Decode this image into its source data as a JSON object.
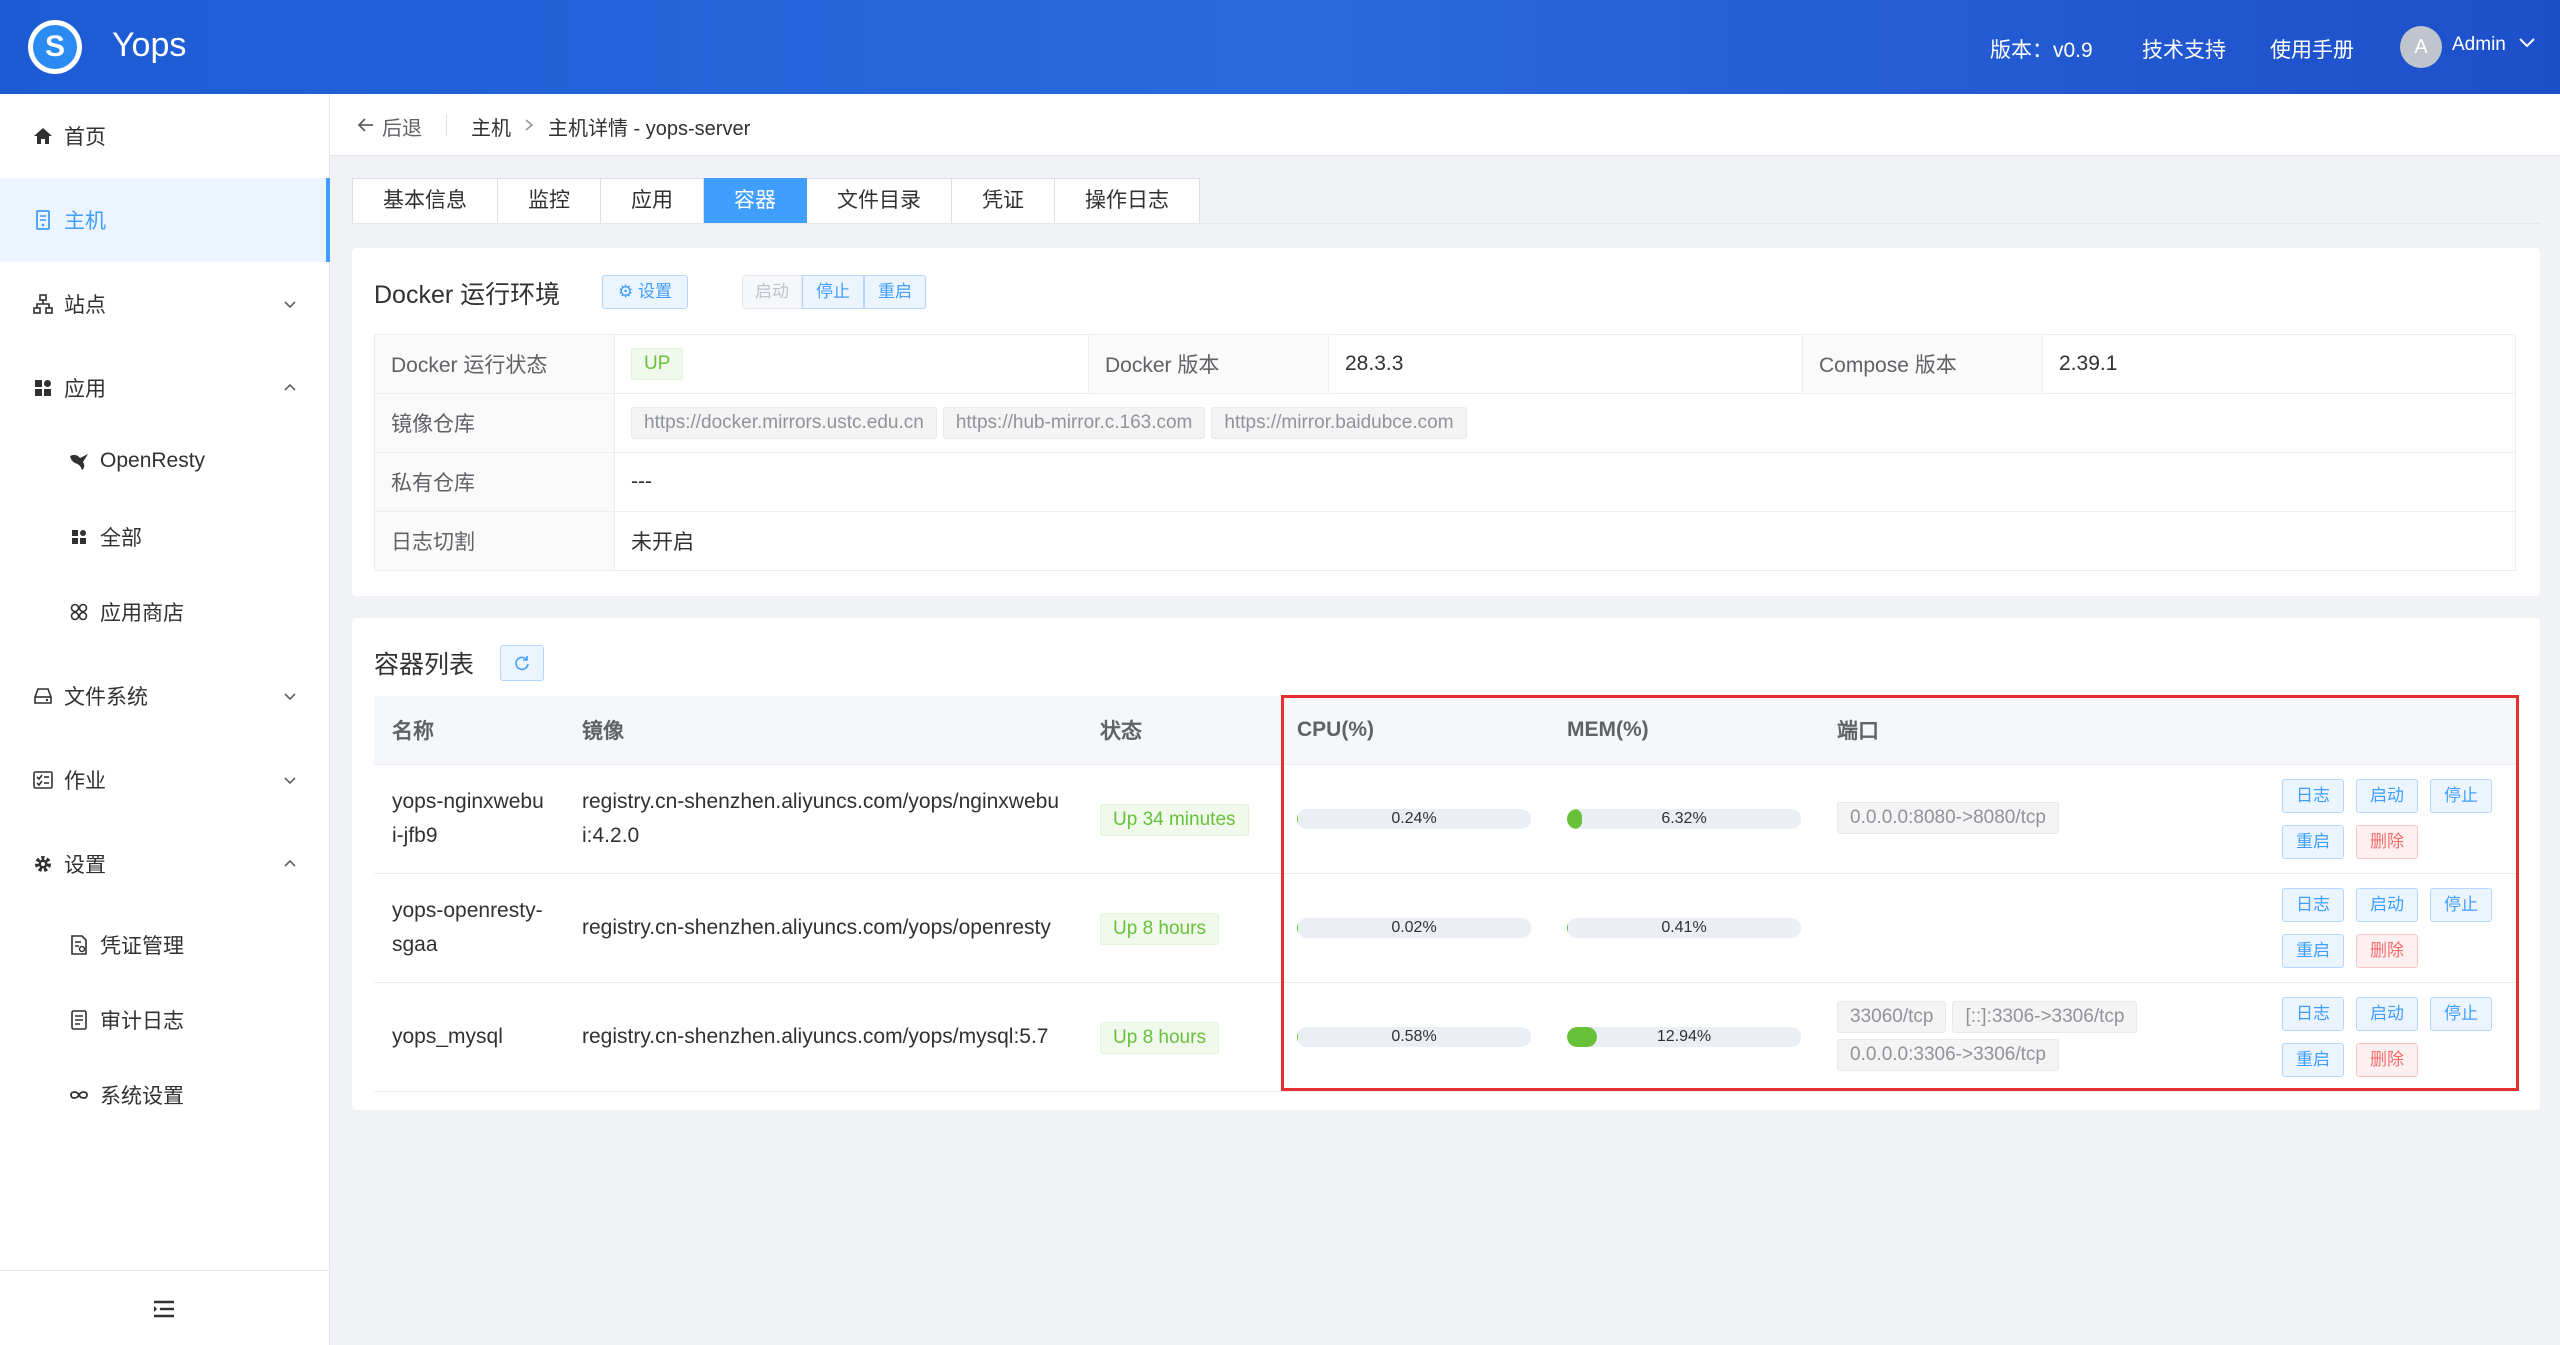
{
  "header": {
    "app_title": "Yops",
    "version": "版本：v0.9",
    "support": "技术支持",
    "manual": "使用手册",
    "avatar_letter": "A",
    "user": "Admin"
  },
  "sidebar": {
    "home": "首页",
    "host": "主机",
    "site": "站点",
    "app": "应用",
    "app_children": [
      "OpenResty",
      "全部",
      "应用商店"
    ],
    "filesystem": "文件系统",
    "job": "作业",
    "settings": "设置",
    "settings_children": [
      "凭证管理",
      "审计日志",
      "系统设置"
    ]
  },
  "breadcrumb": {
    "back": "后退",
    "host": "主机",
    "detail": "主机详情 - yops-server"
  },
  "tabs": [
    "基本信息",
    "监控",
    "应用",
    "容器",
    "文件目录",
    "凭证",
    "操作日志"
  ],
  "docker_env": {
    "title": "Docker 运行环境",
    "settings_btn": "设置",
    "start_btn": "启动",
    "stop_btn": "停止",
    "restart_btn": "重启",
    "status_label": "Docker 运行状态",
    "status": "UP",
    "version_label": "Docker 版本",
    "version": "28.3.3",
    "compose_label": "Compose 版本",
    "compose": "2.39.1",
    "mirror_label": "镜像仓库",
    "mirrors": [
      "https://docker.mirrors.ustc.edu.cn",
      "https://hub-mirror.c.163.com",
      "https://mirror.baidubce.com"
    ],
    "private_label": "私有仓库",
    "private": "---",
    "log_label": "日志切割",
    "log": "未开启"
  },
  "container_list": {
    "title": "容器列表",
    "columns": {
      "name": "名称",
      "image": "镜像",
      "status": "状态",
      "cpu": "CPU(%)",
      "mem": "MEM(%)",
      "ports": "端口"
    },
    "ops": {
      "log": "日志",
      "start": "启动",
      "stop": "停止",
      "restart": "重启",
      "delete": "删除"
    },
    "rows": [
      {
        "name": "yops-nginxwebui-jfb9",
        "image": "registry.cn-shenzhen.aliyuncs.com/yops/nginxwebui:4.2.0",
        "status": "Up 34 minutes",
        "cpu": 0.24,
        "cpu_text": "0.24%",
        "mem": 6.32,
        "mem_text": "6.32%",
        "ports": [
          "0.0.0.0:8080->8080/tcp"
        ]
      },
      {
        "name": "yops-openresty-sgaa",
        "image": "registry.cn-shenzhen.aliyuncs.com/yops/openresty",
        "status": "Up 8 hours",
        "cpu": 0.02,
        "cpu_text": "0.02%",
        "mem": 0.41,
        "mem_text": "0.41%",
        "ports": []
      },
      {
        "name": "yops_mysql",
        "image": "registry.cn-shenzhen.aliyuncs.com/yops/mysql:5.7",
        "status": "Up 8 hours",
        "cpu": 0.58,
        "cpu_text": "0.58%",
        "mem": 12.94,
        "mem_text": "12.94%",
        "ports": [
          "33060/tcp",
          "[::]:3306->3306/tcp",
          "0.0.0.0:3306->3306/tcp"
        ]
      }
    ]
  }
}
